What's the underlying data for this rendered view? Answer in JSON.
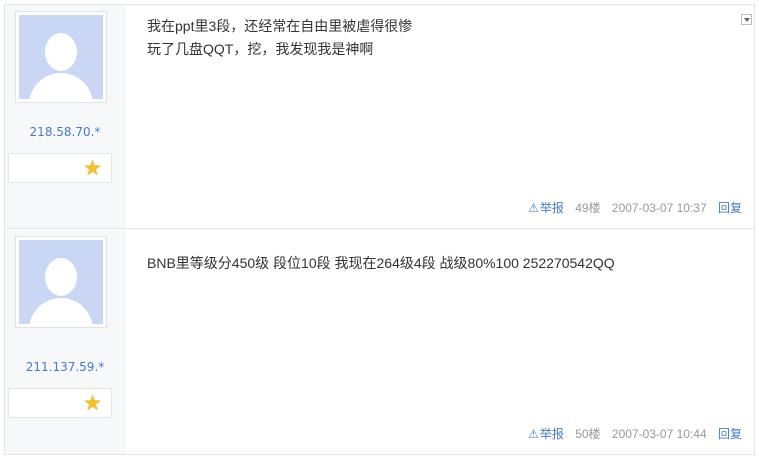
{
  "posts": [
    {
      "ip": "218.58.70.*",
      "lines": [
        "我在ppt里3段，还经常在自由里被虐得很惨",
        "玩了几盘QQT，挖，我发现我是神啊"
      ],
      "report_label": "举报",
      "floor": "49楼",
      "time": "2007-03-07 10:37",
      "reply_label": "回复"
    },
    {
      "ip": "211.137.59.*",
      "lines": [
        "BNB里等级分450级 段位10段 我现在264级4段 战级80%100 252270542QQ"
      ],
      "report_label": "举报",
      "floor": "50楼",
      "time": "2007-03-07 10:44",
      "reply_label": "回复"
    }
  ],
  "colors": {
    "link": "#4a79c9",
    "meta": "#999999",
    "avatar_bg": "#c9d7f5",
    "star": "#f2c230"
  },
  "icons": {
    "rank": "star-icon",
    "report": "warning-icon",
    "menu": "chevron-down-icon",
    "avatar": "default-avatar-icon"
  }
}
